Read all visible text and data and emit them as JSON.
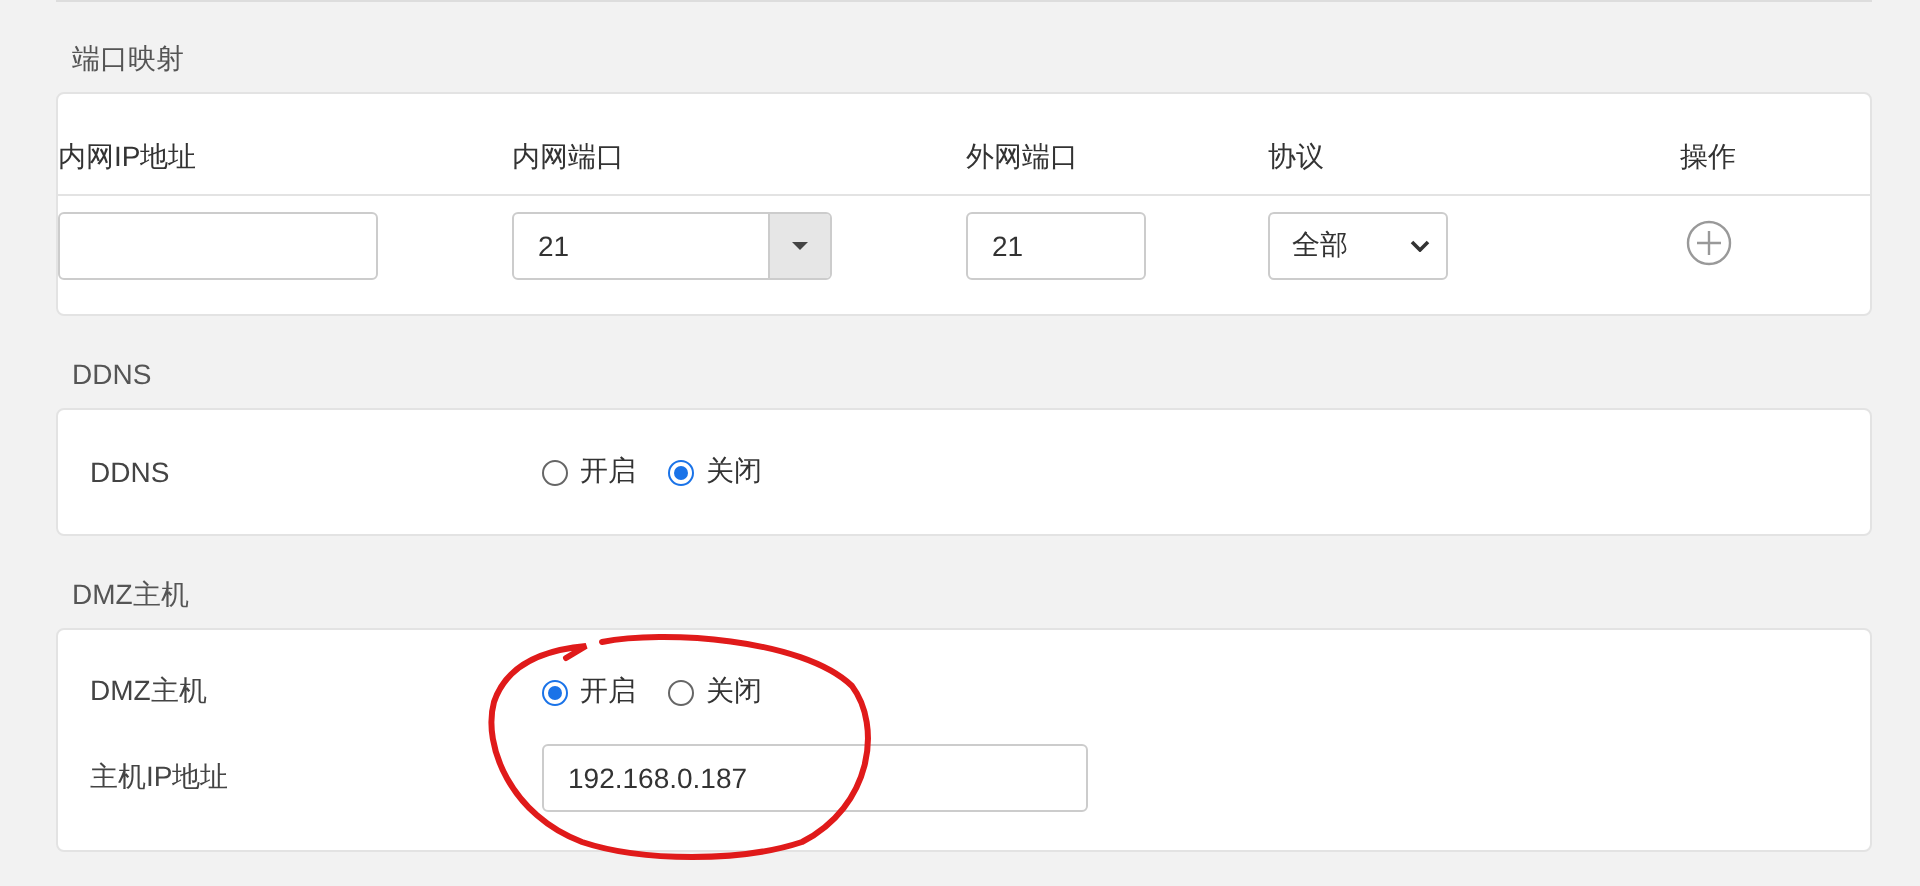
{
  "port_mapping": {
    "title": "端口映射",
    "columns": [
      "内网IP地址",
      "内网端口",
      "外网端口",
      "协议",
      "操作"
    ],
    "row": {
      "internal_port": "21",
      "external_port": "21",
      "protocol": "全部"
    }
  },
  "ddns": {
    "title": "DDNS",
    "label": "DDNS",
    "options": [
      {
        "label": "开启",
        "selected": false
      },
      {
        "label": "关闭",
        "selected": true
      }
    ]
  },
  "dmz": {
    "title": "DMZ主机",
    "label": "DMZ主机",
    "options": [
      {
        "label": "开启",
        "selected": true
      },
      {
        "label": "关闭",
        "selected": false
      }
    ],
    "host_ip_label": "主机IP地址",
    "host_ip": "192.168.0.187"
  }
}
